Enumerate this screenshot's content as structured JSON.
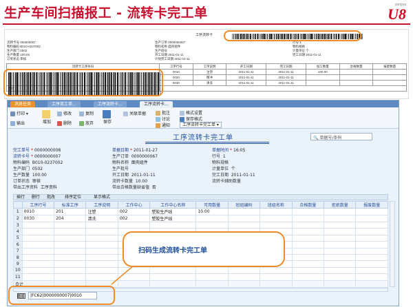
{
  "slide": {
    "title": "生产车间扫描报工 - 流转卡完工单",
    "logo_small": "yonyou",
    "logo_big": "U8",
    "callout": "扫码生成流转卡完工单"
  },
  "card": {
    "title": "工序流转卡",
    "left_fields": [
      "流转卡号 000000007",
      "物料编码 B010-0237002",
      "生产部门 0502",
      "生产数量 100.00",
      "订单状态 审核"
    ],
    "mid_fields": [
      "生产订单 0000000067",
      "物料名称 面壳组件",
      "生产批号",
      "开工日期 2011-01-11",
      "计划完工日期 2011-01-11"
    ],
    "right_fields": [
      "行号 1",
      "物料规格",
      "计量单位 个",
      "完工日期 2011-01-11"
    ],
    "table_headers": [
      "流转卡工序条码",
      "工序行号",
      "工序说明",
      "开工日期",
      "完工日期",
      "加工数量",
      "合格数量",
      "报废数量"
    ],
    "rows": [
      [
        "0010",
        "注塑",
        "2011-01-11",
        "2011-01-11",
        "100.00"
      ],
      [
        "0020",
        "精冲",
        "2011-01-11",
        "2011-01-11",
        ""
      ],
      [
        "0030",
        "清洗",
        "2011-01-11",
        "2011-01-11",
        ""
      ]
    ],
    "footer": "合计"
  },
  "tabs": [
    "消息任务",
    "工序流工单...",
    "工序流转卡...",
    "工序流转卡..."
  ],
  "toolbar": {
    "print": "打印",
    "output": "输出",
    "add": "增加",
    "modify": "修改",
    "delete": "删除",
    "copy": "复制",
    "abandon": "放弃",
    "save": "保存",
    "relate": "关联单据",
    "approve": "批注",
    "discuss": "讨论",
    "notify": "通知",
    "format_setting": "格式设置",
    "save_format": "保存格式",
    "format_select": "工序流转卡完工单"
  },
  "form": {
    "title": "工序流转卡完工单",
    "search_placeholder": "单据号/条码",
    "fields": {
      "doc_no_label": "完工单号",
      "doc_no": "0000000008",
      "doc_date_label": "单据日期",
      "doc_date": "2011-01-27",
      "doc_time_label": "单据时间",
      "doc_time": "16:05",
      "card_no_label": "流转卡号",
      "card_no": "0000000007",
      "order_label": "生产订单",
      "order": "0000000067",
      "line_label": "行号",
      "line": "1",
      "material_code_label": "物料编码",
      "material_code": "B010-0237002",
      "material_name_label": "物料名称",
      "material_name": "面壳组件",
      "spec_label": "物料规格",
      "spec": "",
      "dept_label": "生产部门",
      "dept": "0502",
      "batch_label": "生产批号",
      "batch": "",
      "unit_label": "计量单位",
      "unit": "个",
      "qty_label": "生产数量",
      "qty": "100.00",
      "start_label": "开工日期",
      "start": "2011-01-11",
      "finish_label": "完工日期",
      "finish": "2011-01-11",
      "status_label": "订单状态",
      "status": "审核",
      "card_qty_label": "流转卡数量",
      "card_qty": "10.00",
      "multi_qty_label": "流转卡辅助数量",
      "multi_qty": "",
      "out_process_label": "带出工序资料",
      "out_process": "工序资料",
      "out_missing_label": "带出合格数量缺省值",
      "out_missing": "否"
    }
  },
  "subbar": [
    "插行",
    "删行",
    "批改",
    "排序定位",
    "显示格式"
  ],
  "grid": {
    "headers": [
      "工序行号",
      "标准工序",
      "工序说明",
      "工作中心",
      "工作中心名称",
      "可用数量",
      "班组编码",
      "班组名称",
      "合格数量",
      "拒绝数量",
      "报废数量"
    ],
    "rows": [
      [
        "0010",
        "201",
        "注塑",
        "002",
        "塑胶生产线",
        "10.00",
        "",
        "",
        "",
        "",
        ""
      ],
      [
        "0030",
        "204",
        "清洗",
        "002",
        "塑胶生产线",
        "",
        "",
        "",
        "",
        "",
        ""
      ]
    ],
    "empty_rows": 9,
    "sum_label": "合计"
  },
  "scan": {
    "value": "|FC62|0000000007|0010"
  }
}
